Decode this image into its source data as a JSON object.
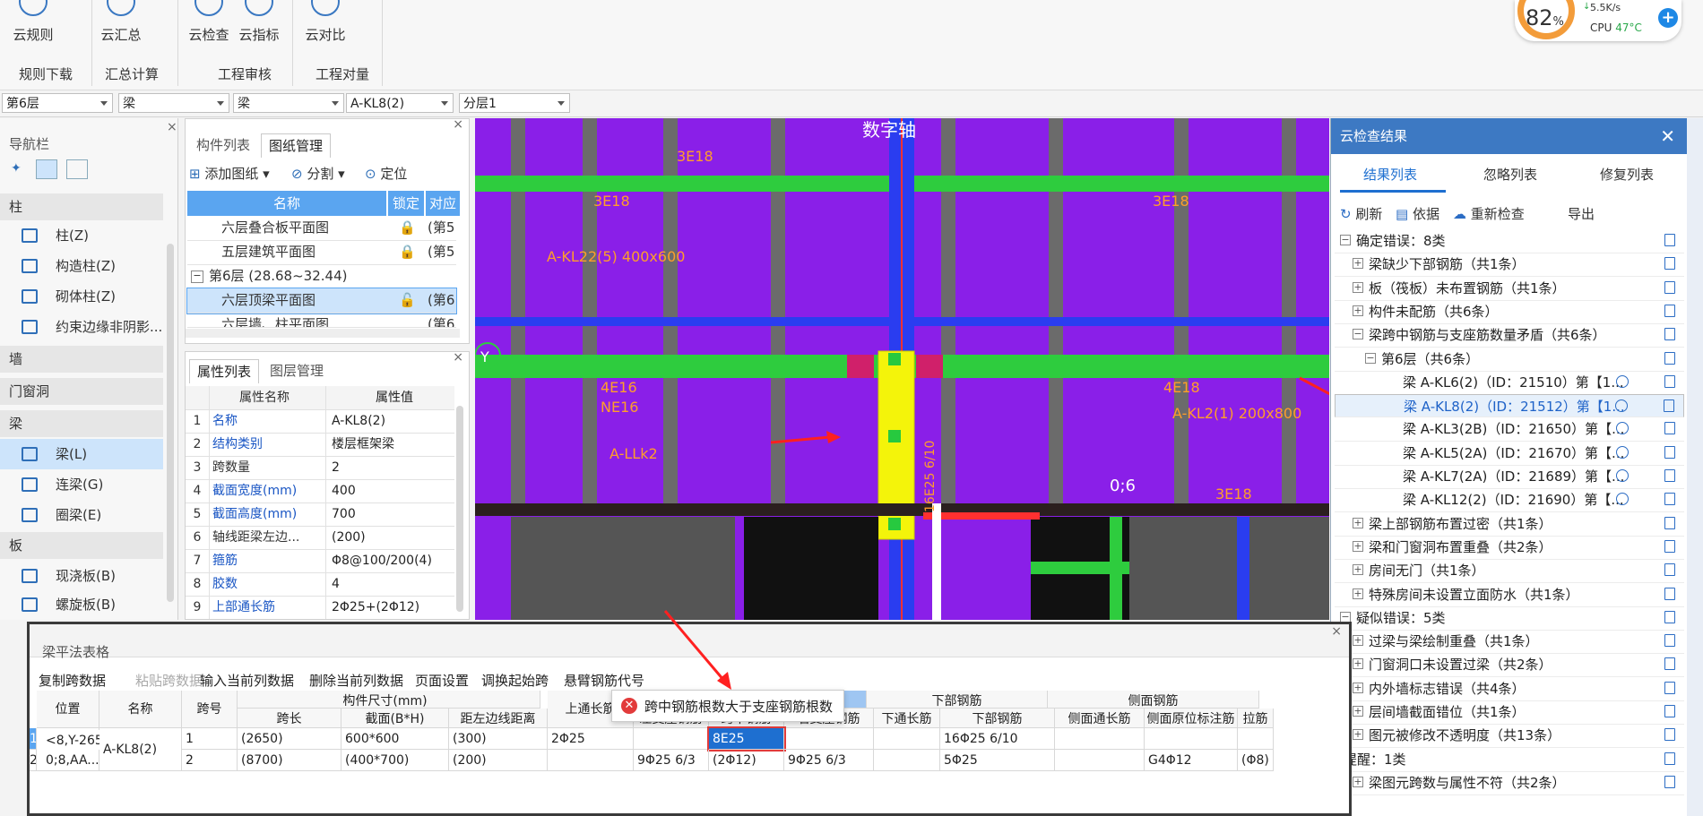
{
  "ribbon": {
    "buttons": [
      {
        "label": "云规则",
        "icon": "info-icon"
      },
      {
        "label": "云汇总",
        "icon": "sigma-icon"
      },
      {
        "label": "云检查",
        "icon": "search-icon"
      },
      {
        "label": "云指标",
        "icon": "chart-icon"
      },
      {
        "label": "云对比",
        "icon": "compare-icon"
      }
    ],
    "groups": [
      "规则下载",
      "汇总计算",
      "工程审核",
      "工程对量"
    ]
  },
  "perf": {
    "percent": "82",
    "percent_unit": "%",
    "speed": "5.5K/s",
    "cpu_label": "CPU",
    "cpu_temp": "47°C"
  },
  "selectors": [
    "第6层",
    "梁",
    "梁",
    "A-KL8(2)",
    "分层1"
  ],
  "nav": {
    "title": "导航栏",
    "cats": {
      "col": "柱",
      "wall": "墙",
      "opening": "门窗洞",
      "beam": "梁",
      "slab": "板"
    },
    "items": {
      "col1": "柱(Z)",
      "col2": "构造柱(Z)",
      "col3": "砌体柱(Z)",
      "col4": "约束边缘非阴影...",
      "beam1": "梁(L)",
      "beam2": "连梁(G)",
      "beam3": "圈梁(E)",
      "slab1": "现浇板(B)",
      "slab2": "螺旋板(B)"
    }
  },
  "comp": {
    "tab1": "构件列表",
    "tab2": "图纸管理",
    "add": "添加图纸",
    "split": "分割",
    "locate": "定位",
    "cols": [
      "名称",
      "锁定",
      "对应"
    ],
    "rows": [
      {
        "name": "六层叠合板平面图",
        "ref": "(第5"
      },
      {
        "name": "五层建筑平面图",
        "ref": "(第5"
      },
      {
        "name": "第6层 (28.68~32.44)",
        "ref": ""
      },
      {
        "name": "六层顶梁平面图",
        "ref": "(第6"
      },
      {
        "name": "六层墙、柱平面图",
        "ref": "(第6"
      }
    ]
  },
  "props": {
    "tab1": "属性列表",
    "tab2": "图层管理",
    "cols": [
      "属性名称",
      "属性值"
    ],
    "rows": [
      {
        "n": "1",
        "k": "名称",
        "v": "A-KL8(2)"
      },
      {
        "n": "2",
        "k": "结构类别",
        "v": "楼层框架梁"
      },
      {
        "n": "3",
        "k": "跨数量",
        "v": "2"
      },
      {
        "n": "4",
        "k": "截面宽度(mm)",
        "v": "400"
      },
      {
        "n": "5",
        "k": "截面高度(mm)",
        "v": "700"
      },
      {
        "n": "6",
        "k": "轴线距梁左边...",
        "v": "(200)"
      },
      {
        "n": "7",
        "k": "箍筋",
        "v": "Φ8@100/200(4)"
      },
      {
        "n": "8",
        "k": "胶数",
        "v": "4"
      },
      {
        "n": "9",
        "k": "上部通长筋",
        "v": "2Φ25+(2Φ12)"
      }
    ]
  },
  "cad": {
    "labels": [
      "数字轴",
      "3E18",
      "3E18",
      "3E18",
      "3E18",
      "4E16",
      "NE16",
      "4E18",
      "4E18",
      "A-LLk2",
      "0;6",
      "3E18",
      "Y",
      "16E25 6/10",
      "A-KL22(5) 400x600",
      "A-KL2(1) 200x800"
    ]
  },
  "cloud": {
    "title": "云检查结果",
    "tabs": [
      "结果列表",
      "忽略列表",
      "修复列表"
    ],
    "tools": [
      "刷新",
      "依据",
      "重新检查",
      "导出"
    ],
    "rows": [
      "确定错误：8类",
      "梁缺少下部钢筋（共1条）",
      "板（筏板）未布置钢筋（共1条）",
      "构件未配筋（共6条）",
      "梁跨中钢筋与支座筋数量矛盾（共6条）",
      "第6层（共6条）",
      "梁 A-KL6(2)（ID：21510）第【1...",
      "梁 A-KL8(2)（ID：21512）第【1...",
      "梁 A-KL3(2B)（ID：21650）第【...",
      "梁 A-KL5(2A)（ID：21670）第【...",
      "梁 A-KL7(2A)（ID：21689）第【...",
      "梁 A-KL12(2)（ID：21690）第【...",
      "梁上部钢筋布置过密（共1条）",
      "梁和门窗洞布置重叠（共2条）",
      "房间无门（共1条）",
      "特殊房间未设置立面防水（共1条）",
      "疑似错误：5类",
      "过梁与梁绘制重叠（共1条）",
      "门窗洞口未设置过梁（共2条）",
      "内外墙标志错误（共4条）",
      "层间墙截面错位（共1条）",
      "图元被修改不透明度（共13条）",
      "提醒：1类",
      "梁图元跨数与属性不符（共2条）"
    ]
  },
  "dialog": {
    "title": "梁平法表格",
    "tools": [
      "复制跨数据",
      "粘贴跨数据",
      "输入当前列数据",
      "删除当前列数据",
      "页面设置",
      "调换起始跨",
      "悬臂钢筋代号"
    ],
    "groups": [
      "构件尺寸(mm)",
      "下部钢筋",
      "侧面钢筋"
    ],
    "cols": [
      "位置",
      "名称",
      "跨号",
      "跨长",
      "截面(B*H)",
      "距左边线距离",
      "上通长筋",
      "左支座钢筋",
      "跨中钢筋",
      "右支座钢筋",
      "下通长筋",
      "下部钢筋",
      "侧面通长筋",
      "侧面原位标注筋",
      "拉筋"
    ],
    "pos": "<8,Y-265",
    "pos2": "0;8,AA...",
    "name": "A-KL8(2)",
    "rows": [
      {
        "span": "1",
        "len": "(2650)",
        "sec": "600*600",
        "dist": "(300)",
        "top": "2Φ25",
        "left": "",
        "mid": "8E25",
        "right": "",
        "bot": "16Φ25 6/10",
        "side": "",
        "tie": ""
      },
      {
        "span": "2",
        "len": "(8700)",
        "sec": "(400*700)",
        "dist": "(200)",
        "top": "",
        "left": "9Φ25 6/3",
        "mid": "(2Φ12)",
        "right": "9Φ25 6/3",
        "bot": "5Φ25",
        "side": "G4Φ12",
        "tie": "(Φ8)"
      }
    ],
    "tooltip": "跨中钢筋根数大于支座钢筋根数"
  }
}
